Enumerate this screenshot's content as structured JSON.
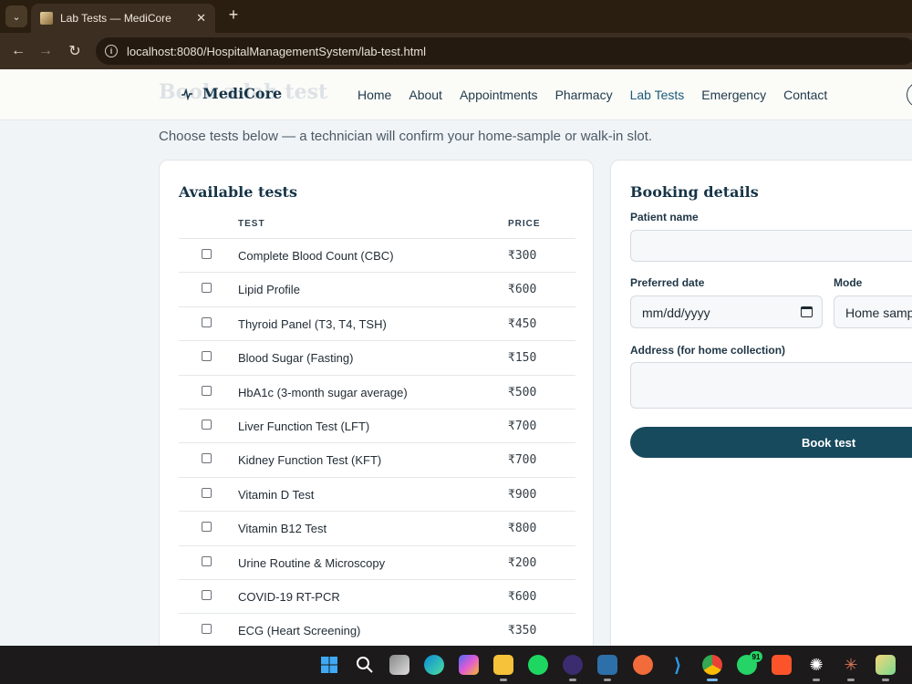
{
  "browser": {
    "tab_title": "Lab Tests — MediCore",
    "url": "localhost:8080/HospitalManagementSystem/lab-test.html"
  },
  "site": {
    "brand": "MediCore",
    "ghost_title": "Book a lab test",
    "nav": [
      {
        "label": "Home",
        "active": false
      },
      {
        "label": "About",
        "active": false
      },
      {
        "label": "Appointments",
        "active": false
      },
      {
        "label": "Pharmacy",
        "active": false
      },
      {
        "label": "Lab Tests",
        "active": true
      },
      {
        "label": "Emergency",
        "active": false
      },
      {
        "label": "Contact",
        "active": false
      }
    ],
    "accent_color": "#184a5e"
  },
  "subtitle": "Choose tests below — a technician will confirm your home-sample or walk-in slot.",
  "tests_card": {
    "title": "Available tests",
    "col_test": "TEST",
    "col_price": "PRICE",
    "rows": [
      {
        "name": "Complete Blood Count (CBC)",
        "price": "₹300"
      },
      {
        "name": "Lipid Profile",
        "price": "₹600"
      },
      {
        "name": "Thyroid Panel (T3, T4, TSH)",
        "price": "₹450"
      },
      {
        "name": "Blood Sugar (Fasting)",
        "price": "₹150"
      },
      {
        "name": "HbA1c (3-month sugar average)",
        "price": "₹500"
      },
      {
        "name": "Liver Function Test (LFT)",
        "price": "₹700"
      },
      {
        "name": "Kidney Function Test (KFT)",
        "price": "₹700"
      },
      {
        "name": "Vitamin D Test",
        "price": "₹900"
      },
      {
        "name": "Vitamin B12 Test",
        "price": "₹800"
      },
      {
        "name": "Urine Routine & Microscopy",
        "price": "₹200"
      },
      {
        "name": "COVID-19 RT-PCR",
        "price": "₹600"
      },
      {
        "name": "ECG (Heart Screening)",
        "price": "₹350"
      }
    ]
  },
  "booking": {
    "title": "Booking details",
    "patient_label": "Patient name",
    "patient_value": "",
    "date_label": "Preferred date",
    "date_placeholder": "mm/dd/yyyy",
    "mode_label": "Mode",
    "mode_value": "Home sample",
    "address_label": "Address (for home collection)",
    "address_value": "",
    "submit_label": "Book test"
  },
  "taskbar": {
    "whatsapp_badge": "91"
  }
}
